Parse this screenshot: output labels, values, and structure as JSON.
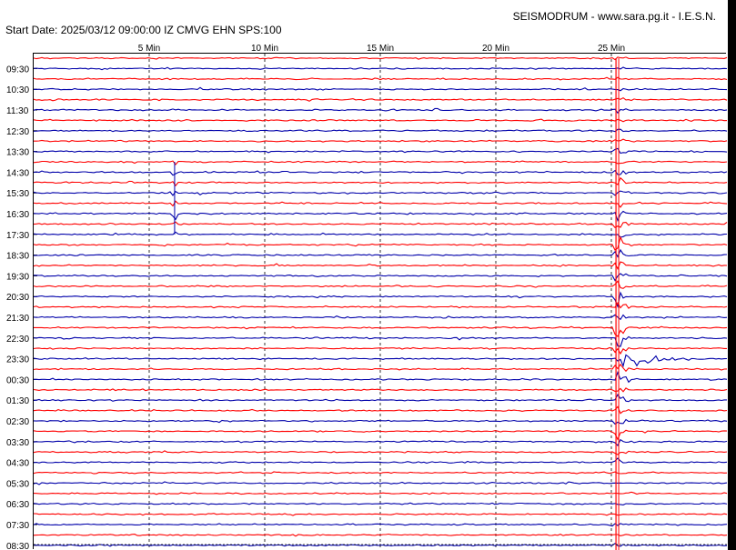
{
  "header": {
    "title": "SEISMODRUM - www.sara.pg.it - I.E.S.N.",
    "subtitle": "Start Date: 2025/03/12 09:00:00 IZ CMVG EHN SPS:100"
  },
  "colors": {
    "trace_a": "#ff0000",
    "trace_b": "#0000aa",
    "grid": "#000000",
    "background": "#ffffff"
  },
  "chart_data": {
    "type": "line",
    "title": "SEISMODRUM - www.sara.pg.it - I.E.S.N.",
    "subtitle": "Start Date: 2025/03/12 09:00:00 IZ CMVG EHN SPS:100",
    "x_unit": "Min",
    "x_range": [
      0,
      30
    ],
    "x_ticks": [
      {
        "value": 5,
        "label": "5 Min"
      },
      {
        "value": 10,
        "label": "10 Min"
      },
      {
        "value": 15,
        "label": "15 Min"
      },
      {
        "value": 20,
        "label": "20 Min"
      },
      {
        "value": 25,
        "label": "25 Min"
      }
    ],
    "y_tick_labels": [
      "09:30",
      "10:30",
      "11:30",
      "12:30",
      "13:30",
      "14:30",
      "15:30",
      "16:30",
      "17:30",
      "18:30",
      "19:30",
      "20:30",
      "21:30",
      "22:30",
      "23:30",
      "00:30",
      "01:30",
      "02:30",
      "03:30",
      "04:30",
      "05:30",
      "06:30",
      "07:30",
      "08:30"
    ],
    "traces_per_label": 2,
    "grid": true,
    "events": [
      {
        "label": "earthquake",
        "minute": 25.2,
        "start_trace": 0,
        "peak_trace": 29,
        "end_trace": 47
      },
      {
        "label": "spike",
        "minute": 6.1,
        "start_trace": 10,
        "end_trace": 17
      }
    ]
  }
}
